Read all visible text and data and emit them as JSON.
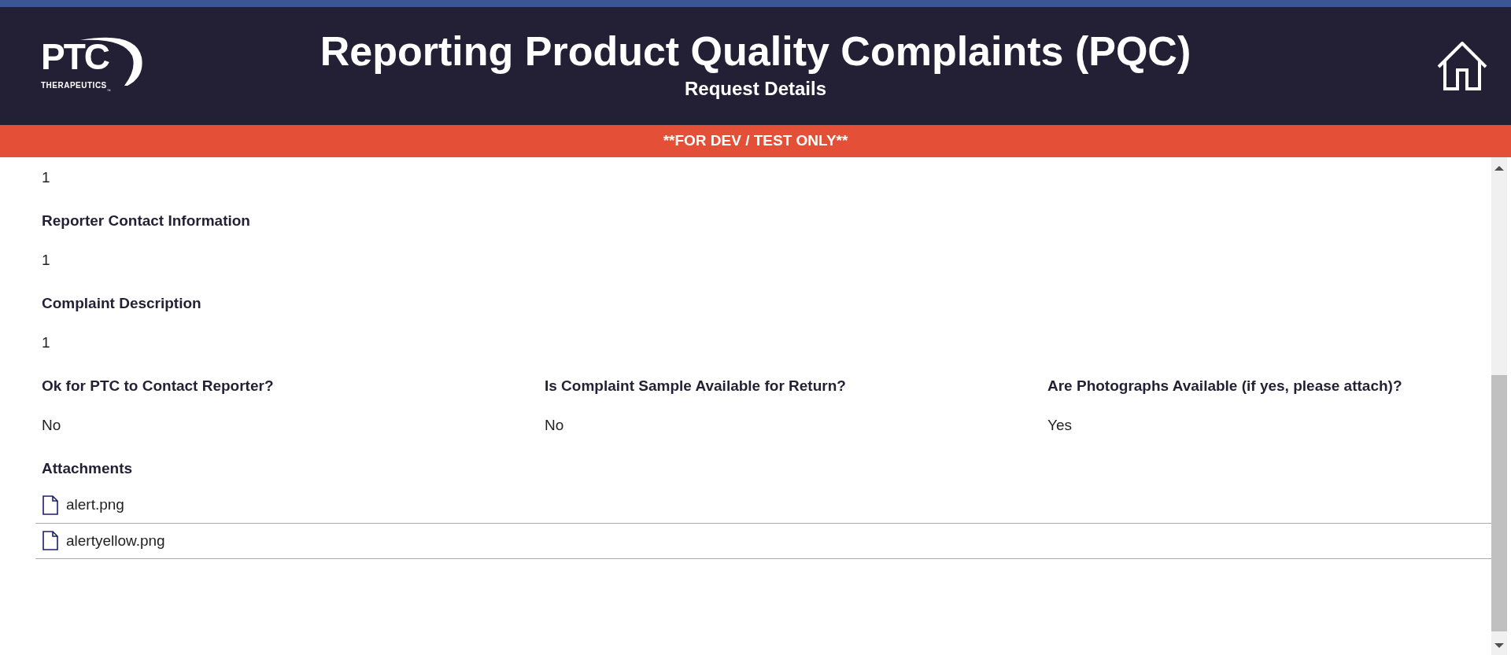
{
  "header": {
    "logo": {
      "wordmark": "PTC",
      "tagline": "THERAPEUTICS",
      "trademark": "™"
    },
    "title": "Reporting Product Quality Complaints (PQC)",
    "subtitle": "Request Details"
  },
  "banner": "**FOR DEV / TEST ONLY**",
  "details": [
    {
      "value": "1"
    },
    {
      "label": "Reporter Contact Information",
      "value": "1"
    },
    {
      "label": "Complaint Description",
      "value": "1"
    }
  ],
  "questions": [
    {
      "label": "Ok for PTC to Contact Reporter?",
      "value": "No"
    },
    {
      "label": "Is Complaint Sample Available for Return?",
      "value": "No"
    },
    {
      "label": "Are Photographs Available (if yes, please attach)?",
      "value": "Yes"
    }
  ],
  "attachments": {
    "label": "Attachments",
    "files": [
      "alert.png",
      "alertyellow.png"
    ]
  }
}
